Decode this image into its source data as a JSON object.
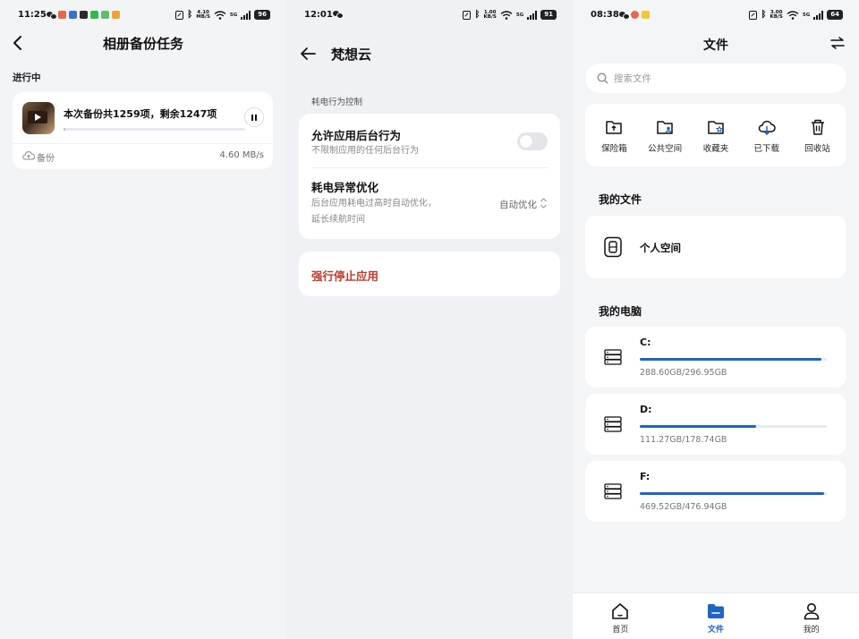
{
  "panel_backup": {
    "status": {
      "time": "11:25",
      "speed_top": "4.10",
      "speed_unit": "MB/S",
      "network": "5G",
      "battery": "96"
    },
    "title": "相册备份任务",
    "section": "进行中",
    "task": {
      "text": "本次备份共1259项，剩余1247项",
      "progress": 0.01,
      "label": "备份",
      "speed": "4.60 MB/s"
    }
  },
  "panel_app": {
    "status": {
      "time": "12:01",
      "speed_top": "1.00",
      "speed_unit": "KB/S",
      "network": "5G",
      "battery": "91"
    },
    "title": "梵想云",
    "section": "耗电行为控制",
    "background": {
      "title": "允许应用后台行为",
      "desc": "不限制应用的任何后台行为",
      "enabled": false
    },
    "optimize": {
      "title": "耗电异常优化",
      "desc1": "后台应用耗电过高时自动优化，",
      "desc2": "延长续航时间",
      "value": "自动优化"
    },
    "force_stop": "强行停止应用"
  },
  "panel_files": {
    "status": {
      "time": "08:38",
      "speed_top": "3.00",
      "speed_unit": "KB/S",
      "network": "5G",
      "battery": "64"
    },
    "title": "文件",
    "search_placeholder": "搜索文件",
    "quick": [
      {
        "label": "保险箱",
        "icon": "safe-box-icon"
      },
      {
        "label": "公共空间",
        "icon": "shared-folder-icon"
      },
      {
        "label": "收藏夹",
        "icon": "favorites-folder-icon"
      },
      {
        "label": "已下载",
        "icon": "download-cloud-icon"
      },
      {
        "label": "回收站",
        "icon": "trash-icon"
      }
    ],
    "my_files": "我的文件",
    "personal": "个人空间",
    "my_computer": "我的电脑",
    "drives": [
      {
        "name": "C:",
        "used": "288.60GB",
        "total": "296.95GB",
        "fraction": 0.972
      },
      {
        "name": "D:",
        "used": "111.27GB",
        "total": "178.74GB",
        "fraction": 0.623
      },
      {
        "name": "F:",
        "used": "469.52GB",
        "total": "476.94GB",
        "fraction": 0.984
      }
    ],
    "nav": [
      {
        "label": "首页",
        "active": false
      },
      {
        "label": "文件",
        "active": true
      },
      {
        "label": "我的",
        "active": false
      }
    ]
  },
  "colors": {
    "accent": "#1e63c8",
    "danger": "#c0392b",
    "toggle_off": "#e3e5e9"
  }
}
